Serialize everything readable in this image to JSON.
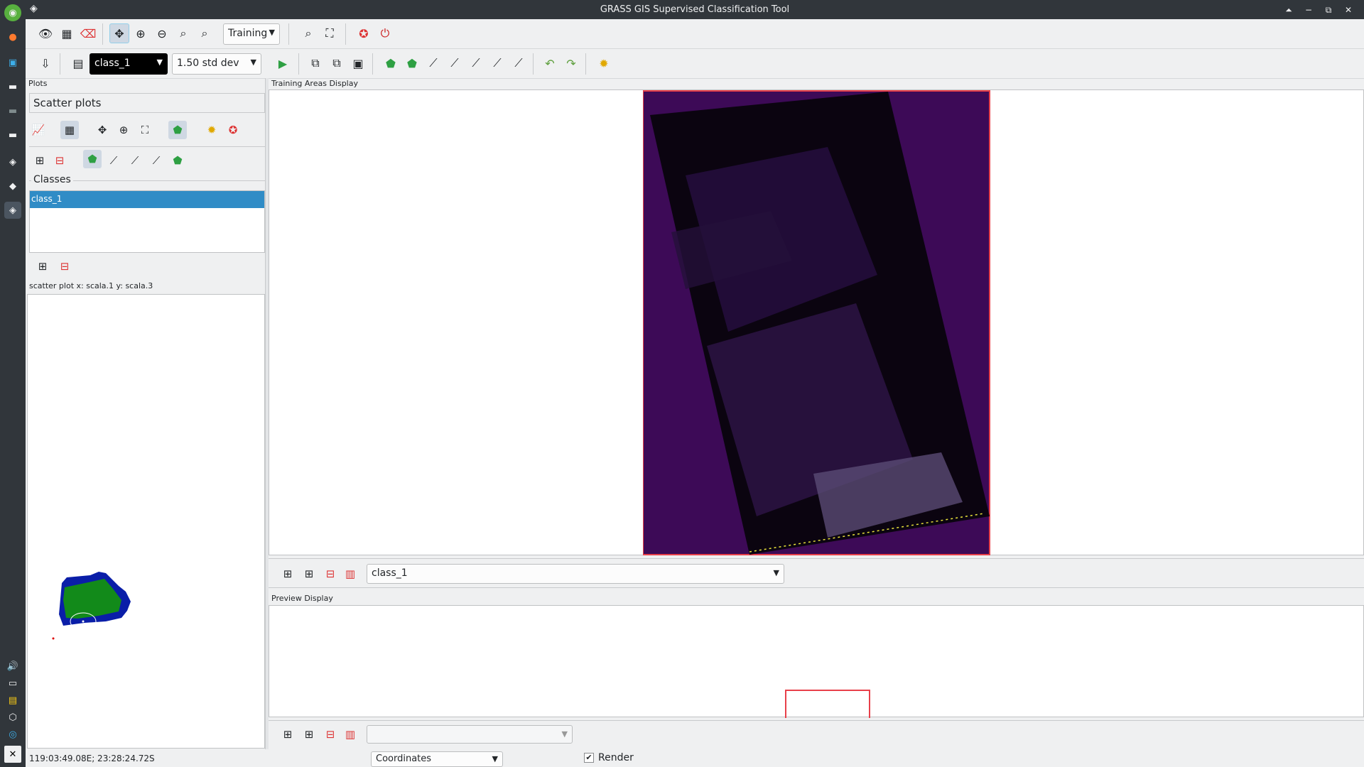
{
  "window": {
    "title": "GRASS GIS Supervised Classification Tool"
  },
  "toolbar1": {
    "mode_combo": "Training"
  },
  "toolbar2": {
    "class_combo": "class_1",
    "stddev_combo": "1.50 std dev"
  },
  "plots": {
    "header": "Plots",
    "scatter_header": "Scatter plots",
    "classes_header": "Classes",
    "classes": [
      "class_1"
    ],
    "scatter_label": "scatter plot x: scala.1 y: scala.3"
  },
  "training": {
    "header": "Training Areas Display",
    "layer_combo": "class_1"
  },
  "preview": {
    "header": "Preview Display",
    "layer_combo": ""
  },
  "statusbar": {
    "coords": "119:03:49.08E; 23:28:24.72S",
    "mode": "Coordinates",
    "render_label": "Render",
    "render_checked": true
  },
  "colors": {
    "accent": "#3daee9",
    "selection": "#308cc6",
    "image_purple": "#3d0a57",
    "frame_red": "#e8404a"
  }
}
